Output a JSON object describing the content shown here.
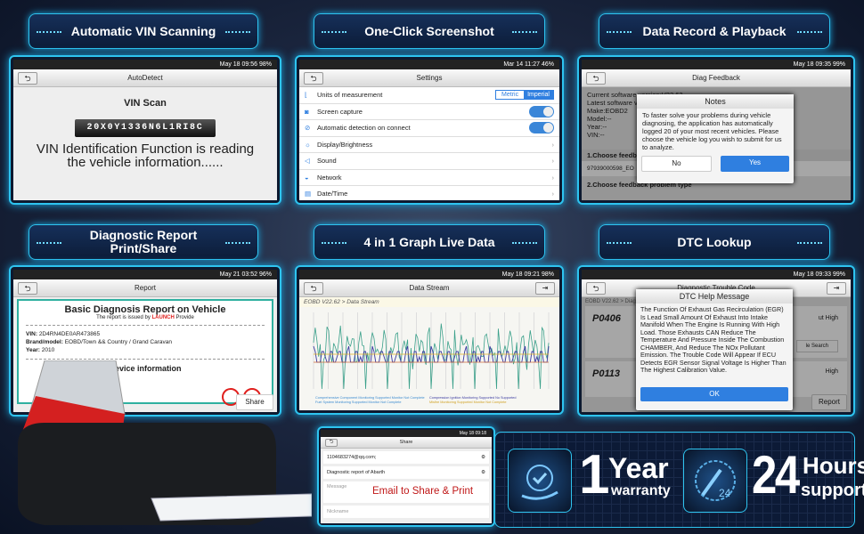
{
  "titles": {
    "vin": "Automatic VIN Scanning",
    "screenshot": "One-Click Screenshot",
    "record": "Data Record & Playback",
    "report": "Diagnostic Report Print/Share",
    "graph": "4 in 1 Graph Live Data",
    "dtc": "DTC Lookup"
  },
  "vin_screen": {
    "status": "May 18   09:56   98%",
    "title": "AutoDetect",
    "heading": "VIN Scan",
    "vin": "20X0Y1336N6L1RI8C",
    "message": "VIN Identification Function is reading the vehicle information......"
  },
  "settings_screen": {
    "status": "Mar 14   11:27   46%",
    "title": "Settings",
    "units_label": "Units of measurement",
    "metric": "Metric",
    "imperial": "Imperial",
    "items": [
      {
        "label": "Units of measurement",
        "icon": "ruler-icon"
      },
      {
        "label": "Screen capture",
        "icon": "camera-icon",
        "toggle": true
      },
      {
        "label": "Automatic detection on connect",
        "icon": "detect-icon",
        "toggle": true
      },
      {
        "label": "Display/Brightness",
        "icon": "brightness-icon"
      },
      {
        "label": "Sound",
        "icon": "sound-icon"
      },
      {
        "label": "Network",
        "icon": "wifi-icon"
      },
      {
        "label": "Date/Time",
        "icon": "calendar-icon"
      }
    ]
  },
  "feedback_screen": {
    "status": "May 18   09:35   99%",
    "title": "Diag Feedback",
    "info": [
      "Current software version:V22.62",
      "Latest software v",
      "Make:EOBD2",
      "Model:--",
      "Year:--",
      "VIN:--"
    ],
    "section1": "1.Choose feedba",
    "log_item": "97939000598_EO",
    "section2": "2.Choose feedback problem type",
    "dialog": {
      "title": "Notes",
      "body": "To faster solve your problems during vehicle diagnosing, the application has automatically logged 20 of your most recent vehicles. Please choose the vehicle log you wish to submit for us to analyze.",
      "no": "No",
      "yes": "Yes"
    }
  },
  "report_screen": {
    "status": "May 21   03:52   96%",
    "title": "Report",
    "heading": "Basic Diagnosis Report on Vehicle",
    "issued_prefix": "The report is issued by ",
    "issued_brand": "LAUNCH",
    "issued_suffix": " Provide",
    "vin_label": "VIN: ",
    "vin": "2D4RN4DE0AR473865",
    "brand_label": "Brand/model: ",
    "brand": "EOBD/Town && Country / Grand Caravan",
    "year_label": "Year: ",
    "year": "2010",
    "device_heading": "Device information",
    "share": "Share",
    "brand_color": "#e0201e"
  },
  "stream_screen": {
    "status": "May 18   09:21   98%",
    "title": "Data Stream",
    "breadcrumb": "EOBD V22.62 > Data Stream",
    "legend": [
      "Comprehensive Component Monitoring Supported Monitor Not Complete",
      "Compression Ignition Monitoring Supported No Supported",
      "Fuel System Monitoring Supported Monitor Not Complete",
      "Misfire Monitoring Supported Monitor Not Complete"
    ],
    "colors": [
      "#3aa08a",
      "#3a3aa0",
      "#d06a3a",
      "#e0b020"
    ]
  },
  "dtc_screen": {
    "status": "May 18   09:33   99%",
    "title": "Diagnostic Trouble Code",
    "breadcrumb": "EOBD V22.62 > Diag",
    "codes": [
      "P0406",
      "P0113"
    ],
    "side": [
      "ut High",
      "le Search",
      "High"
    ],
    "report": "Report",
    "dialog": {
      "title": "DTC Help Message",
      "body": "The Function Of Exhaust Gas Recirculation (EGR) Is Lead Small Amount Of Exhaust Into Intake Manifold When The Engine Is Running With High Load. Those Exhausts CAN Reduce The Temperature And Pressure Inside The Combustion CHAMBER, And Reduce The NOx Pollutant Emission. The Trouble Code Will Appear If ECU Detects EGR Sensor Signal Voltage Is Higher Than The Highest Calibration Value.",
      "ok": "OK"
    }
  },
  "share_screen": {
    "status": "May 18   09:18",
    "title": "Share",
    "email": "1104683274@qq.com;",
    "subject": "Diagnostic report of Abarth",
    "message_placeholder": "Message",
    "nickname_placeholder": "Nickname",
    "overlay": "Email to Share &  Print"
  },
  "badges": {
    "warranty_num": "1",
    "warranty_top": "Year",
    "warranty_bottom": "warranty",
    "support_num": "24",
    "support_top": "Hours",
    "support_bottom": "support"
  }
}
